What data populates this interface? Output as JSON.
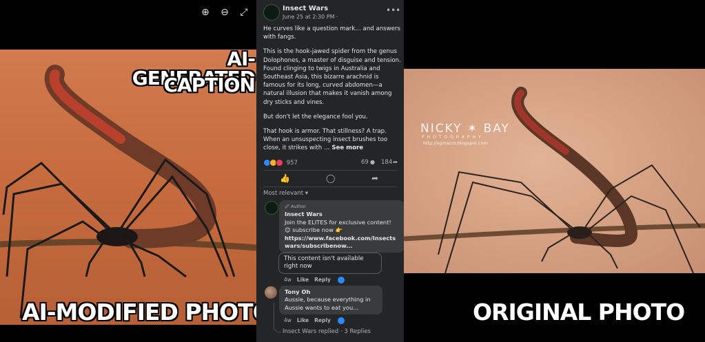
{
  "left_image": {
    "caption_top_line1": "AI-GENERATED",
    "caption_top_line2": "CAPTION",
    "caption_bottom": "AI-MODIFIED PHOTO"
  },
  "viewer_controls": {
    "zoom_in": "⊕",
    "zoom_out": "⊖",
    "fullscreen": "⤢"
  },
  "post": {
    "page_name": "Insect Wars",
    "date": "June 25 at 2:30 PM ·",
    "globe": "⚙",
    "more": "•••",
    "paragraph1": "He curves like a question mark… and answers with fangs.",
    "paragraph2": "This is the hook-jawed spider from the genus Dolophones, a master of disguise and tension. Found clinging to twigs in Australia and Southeast Asia, this bizarre arachnid is famous for its long, curved abdomen—a natural illusion that makes it vanish among dry sticks and vines.",
    "paragraph3": "But don't let the elegance fool you.",
    "paragraph4": "That hook is armor. That stillness? A trap. When an unsuspecting insect brushes too close, it strikes with …",
    "see_more": "See more",
    "reaction_count": "957",
    "comment_count": "69",
    "share_count": "184",
    "like_icon": "👍",
    "comment_icon": "◯",
    "share_icon": "➦",
    "sort_label": "Most relevant ▾"
  },
  "comments": [
    {
      "badge": "🖉 Author",
      "author": "Insect Wars",
      "text": "Join the ELITES for exclusive content! 😊 subscribe now 👉",
      "link": "https://www.facebook.com/Insectswars/subscribenow...",
      "time": "4w",
      "like": "Like",
      "reply": "Reply"
    },
    {
      "author": "Tony Oh",
      "text": "Aussie, because everything in Aussie wants to eat you...",
      "time": "4w",
      "like": "Like",
      "reply": "Reply"
    }
  ],
  "unavailable_notice": "This content isn't available right now",
  "replied_text": "Insect Wars replied · 3 Replies",
  "right_image": {
    "watermark": "NICKY ✶ BAY",
    "watermark_sub": "PHOTOGRAPHY",
    "watermark_url": "http://sgmacro.blogspot.com",
    "caption_bottom": "ORIGINAL PHOTO"
  }
}
